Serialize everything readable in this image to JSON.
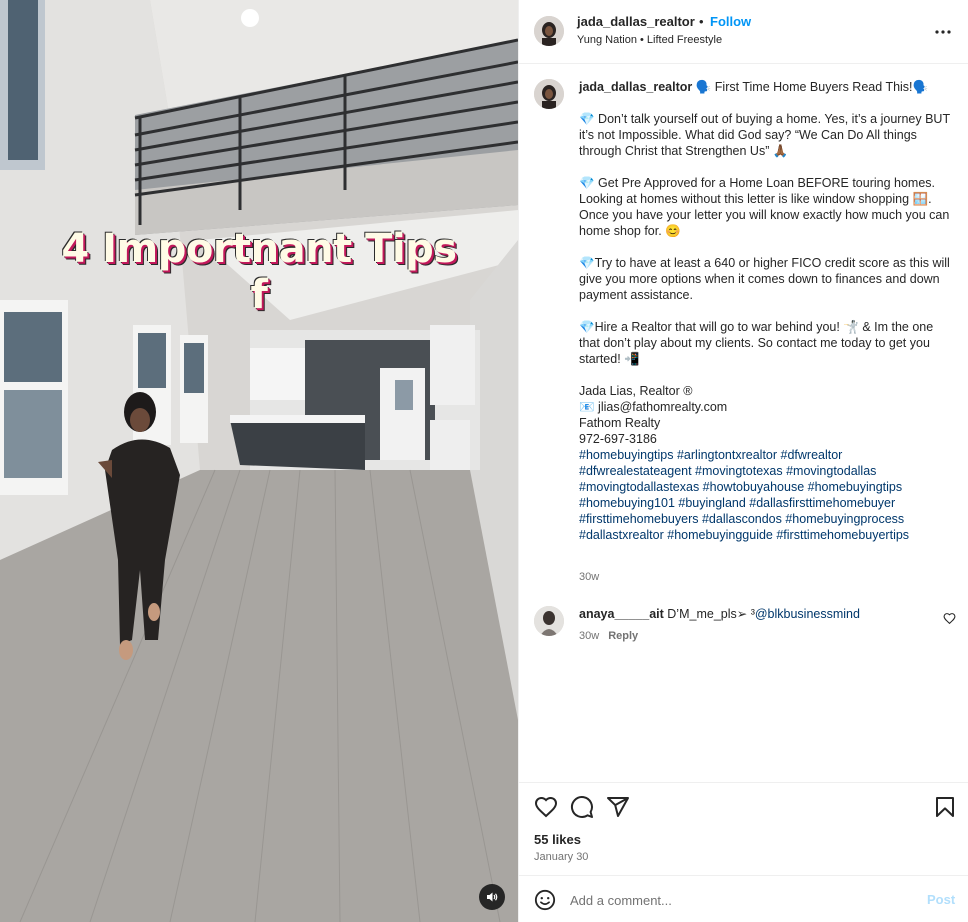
{
  "overlay": {
    "title_line1": "4 Importnant Tips",
    "title_line2": "f"
  },
  "header": {
    "username": "jada_dallas_realtor",
    "dot": "•",
    "follow_label": "Follow",
    "audio": "Yung Nation • Lifted Freestyle",
    "more_icon": "more-horizontal-icon"
  },
  "caption": {
    "username": "jada_dallas_realtor",
    "body": "🗣️ First Time Home Buyers Read This!🗣️\n\n💎 Don’t talk yourself out of buying a home. Yes, it’s a journey BUT it’s not Impossible. What did God say? “We Can Do All things through Christ that Strengthen Us” 🙏🏾\n\n💎 Get Pre Approved for a Home Loan BEFORE touring homes. Looking at homes without this letter is like window shopping 🪟. Once you have your letter you will know exactly how much you can home shop for. 😊\n\n💎Try to have at least a 640 or higher FICO credit score as this will give you more options when it comes down to finances and down payment assistance.\n\n💎Hire a Realtor that will go to war behind you! 🤺 & Im the one that don’t play about my clients. So contact me today to get you started! 📲\n\nJada Lias, Realtor ®\n📧 jlias@fathomrealty.com\nFathom Realty\n972-697-3186\n",
    "hashtags": "#homebuyingtips #arlingtontxrealtor #dfwrealtor #dfwrealestateagent #movingtotexas #movingtodallas #movingtodallastexas #howtobuyahouse #homebuyingtips #homebuying101 #buyingland #dallasfirsttimehomebuyer #firsttimehomebuyers #dallascondos #homebuyingprocess #dallastxrealtor #homebuyingguide #firsttimehomebuyertips",
    "time": "30w"
  },
  "comment": {
    "username": "anaya_____ait",
    "text": "D’M_me_pls➢ ³",
    "mention": "@blkbusinessmind",
    "time": "30w",
    "reply_label": "Reply"
  },
  "actions": {
    "likes": "55 likes",
    "date": "January 30",
    "comment_placeholder": "Add a comment...",
    "post_label": "Post"
  },
  "colors": {
    "link_blue": "#0095f6",
    "hashtag": "#00376b",
    "muted": "#737373",
    "post_disabled": "#b2dffc"
  }
}
